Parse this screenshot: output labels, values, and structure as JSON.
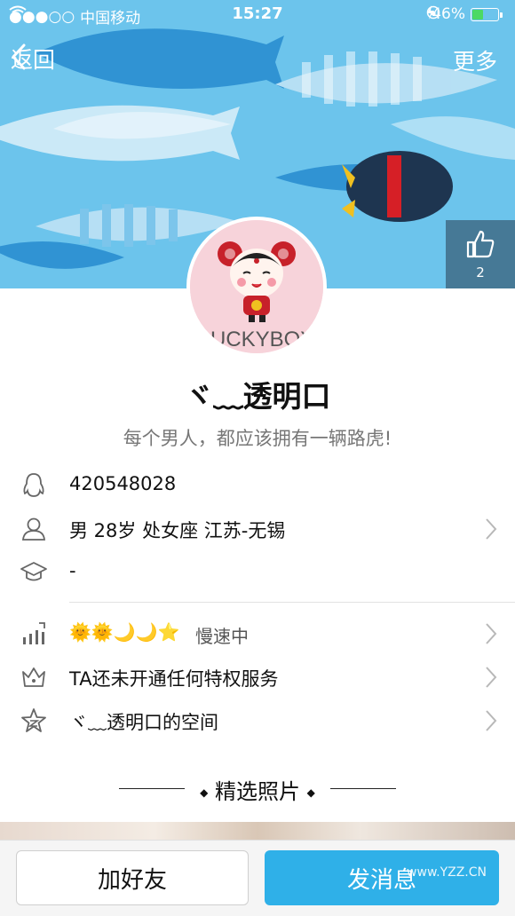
{
  "status_bar": {
    "carrier": "中国移动",
    "time": "15:27",
    "battery": "46%",
    "battery_level": 0.46
  },
  "nav": {
    "back_label": "返回",
    "more_label": "更多"
  },
  "like": {
    "count": "2"
  },
  "avatar": {
    "text": "LUCKYBOY"
  },
  "profile": {
    "name": "ヾ﹏透明口",
    "signature": "每个男人，都应该拥有一辆路虎!"
  },
  "info": {
    "qq": "420548028",
    "basic": "男 28岁 处女座 江苏-无锡",
    "school": "-"
  },
  "level": {
    "badges": "🌞🌞🌙🌙⭐",
    "status": "慢速中"
  },
  "privilege": "TA还未开通任何特权服务",
  "space": "ヾ﹏透明口的空间",
  "photos": {
    "section_title": "精选照片"
  },
  "actions": {
    "add_friend": "加好友",
    "send_message": "发消息",
    "watermark": "www.YZZ.CN"
  },
  "colors": {
    "accent": "#2fb0e8",
    "banner": "#6cc4ec"
  }
}
